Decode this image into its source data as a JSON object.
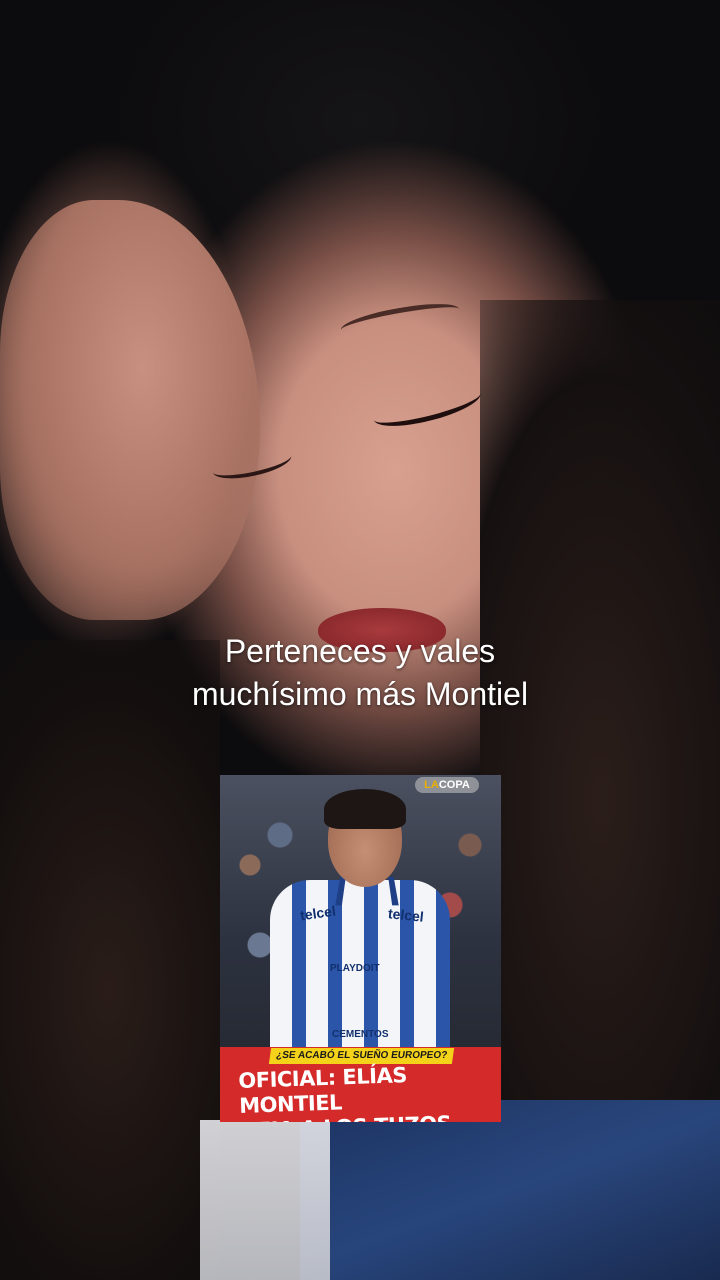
{
  "caption": {
    "line1": "Perteneces y vales",
    "line2": "muchísimo más Montiel"
  },
  "news_card": {
    "logo_la": "LA",
    "logo_copa": "COPA",
    "sponsor_1": "telcel",
    "sponsor_2": "telcel",
    "sponsor_3": "PLAYDOIT",
    "sponsor_4": "CEMENTOS",
    "tag": "¿SE ACABÓ EL SUEÑO EUROPEO?",
    "headline_line1": "OFICIAL: ELÍAS MONTIEL",
    "headline_line2": "DEJA A LOS TUZOS"
  }
}
